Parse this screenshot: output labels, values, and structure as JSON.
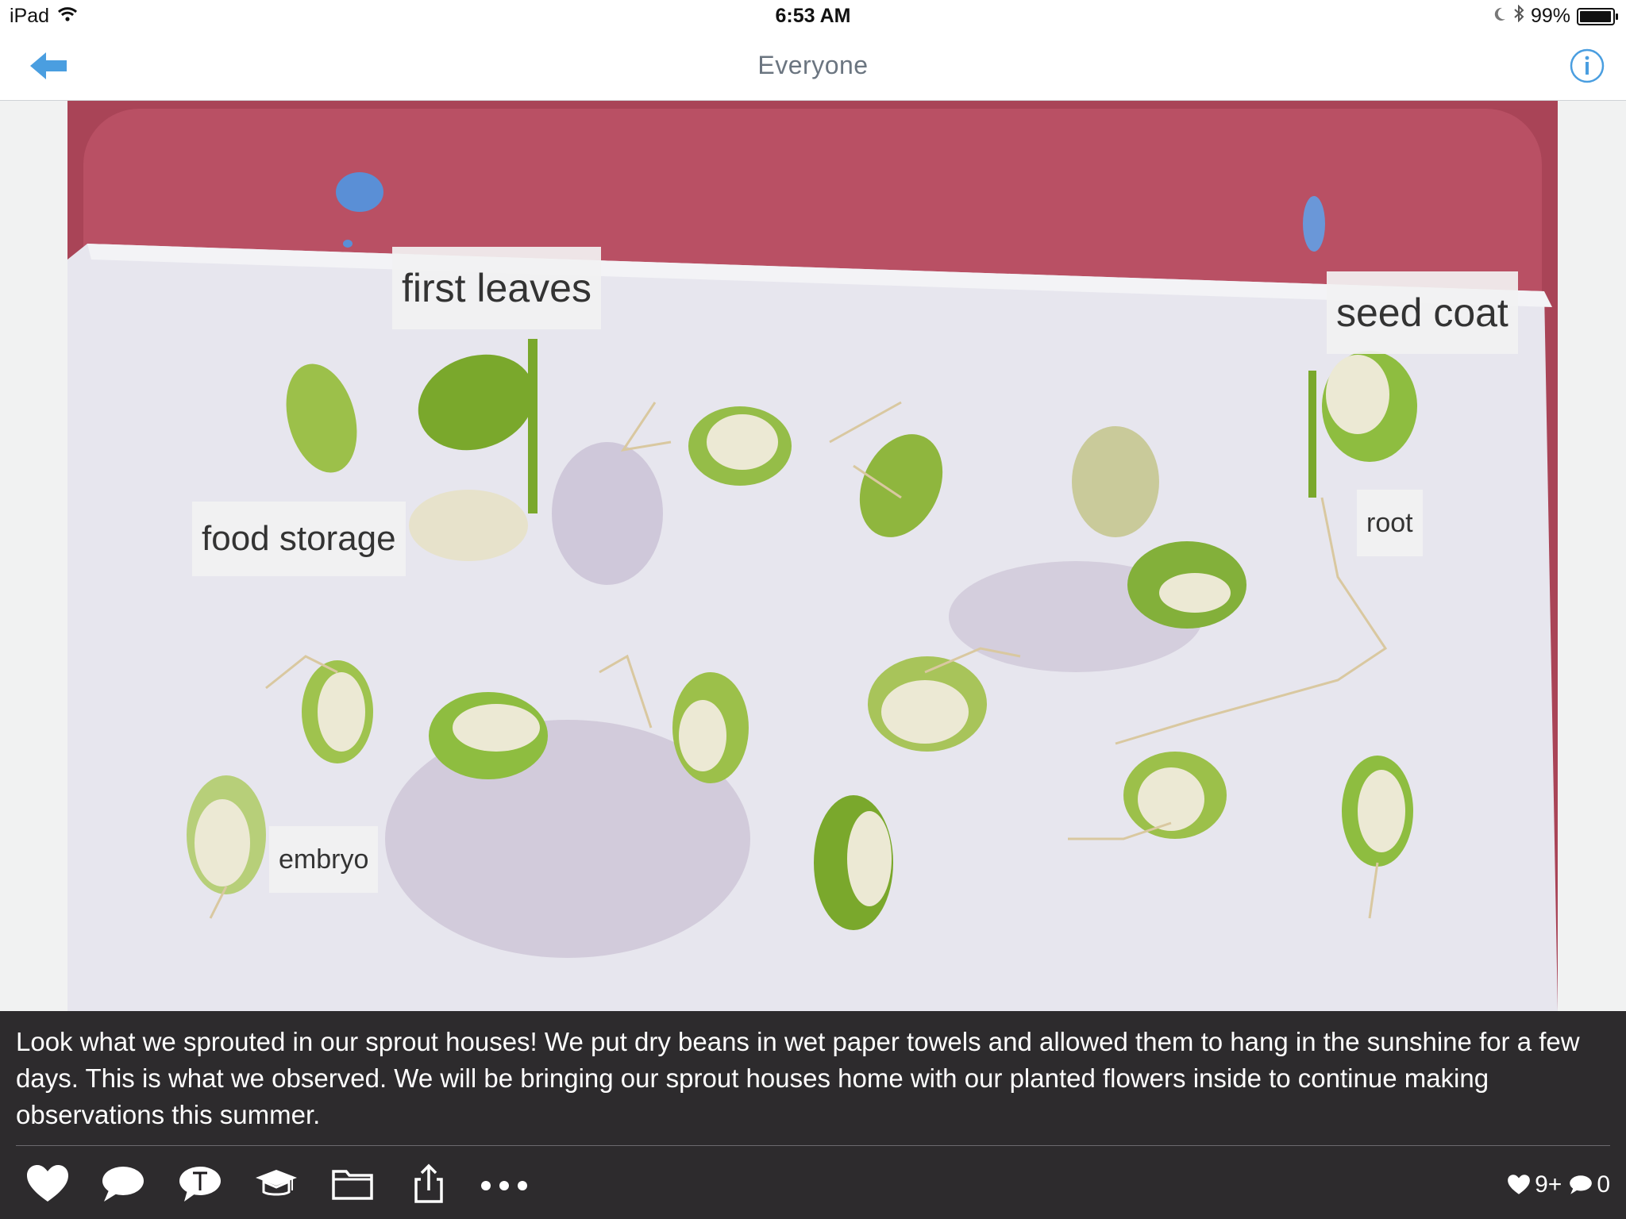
{
  "status_bar": {
    "device": "iPad",
    "time": "6:53 AM",
    "battery": "99%"
  },
  "nav": {
    "title": "Everyone",
    "back_icon": "back-arrow-icon",
    "info_icon": "info-icon"
  },
  "photo": {
    "labels": {
      "first_leaves": "first leaves",
      "seed_coat": "seed coat",
      "food_storage": "food storage",
      "root": "root",
      "embryo": "embryo"
    }
  },
  "caption": {
    "text": "Look what we sprouted in our sprout houses!  We put dry beans in wet paper towels and allowed them to hang in the sunshine for a few days.  This is what we observed.  We will be bringing our sprout houses home with our planted flowers inside to continue making observations this summer."
  },
  "toolbar": {
    "icons": [
      "heart-icon",
      "comment-icon",
      "translate-icon",
      "graduation-cap-icon",
      "folder-icon",
      "share-icon",
      "more-icon"
    ],
    "likes_count": "9+",
    "comments_count": "0"
  },
  "colors": {
    "accent": "#4a9ee0",
    "caption_bg": "#1c1a1c",
    "tray": "#b5465a"
  }
}
